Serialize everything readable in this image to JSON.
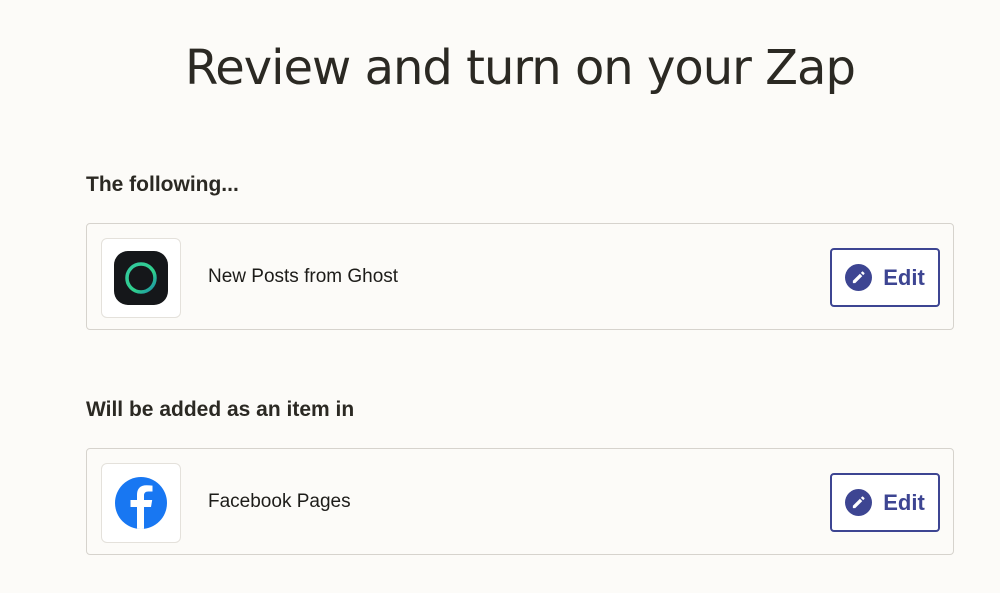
{
  "page": {
    "title": "Review and turn on your Zap"
  },
  "trigger": {
    "heading": "The following...",
    "app_name": "New Posts from Ghost",
    "app_icon": "ghost-logo-icon",
    "edit_label": "Edit"
  },
  "action": {
    "heading": "Will be added as an item in",
    "app_name": "Facebook Pages",
    "app_icon": "facebook-logo-icon",
    "edit_label": "Edit"
  },
  "colors": {
    "background": "#fcfbf8",
    "accent": "#3d4592",
    "facebook_blue": "#1877f2",
    "ghost_dark": "#15171a",
    "ghost_ring": "#2fd08c"
  }
}
